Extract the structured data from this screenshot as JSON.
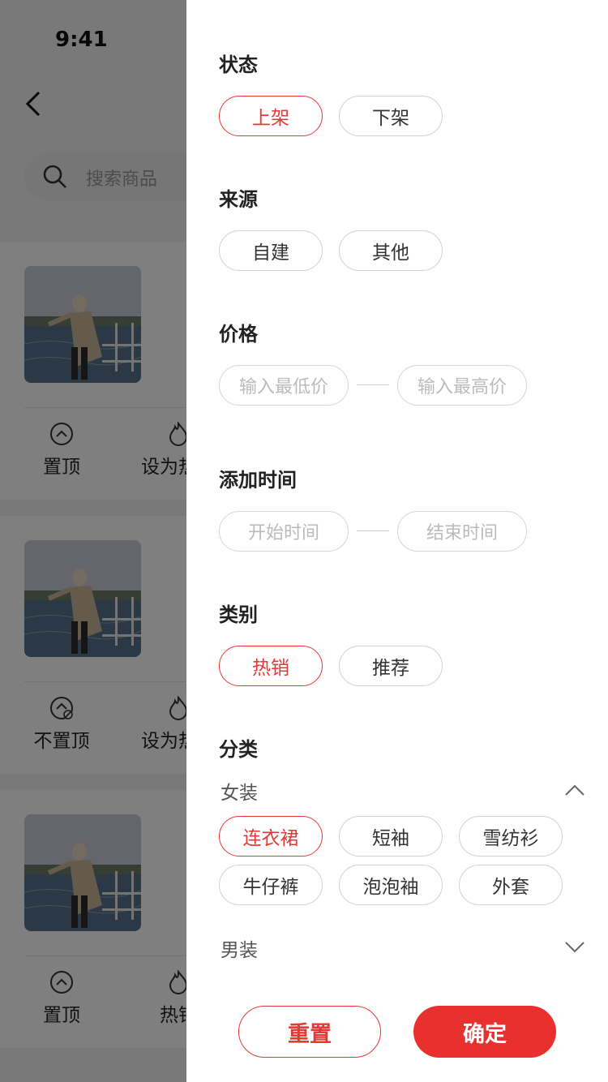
{
  "status_bar": {
    "time": "9:41"
  },
  "search": {
    "placeholder": "搜索商品"
  },
  "products": [
    {
      "actions": [
        "置顶",
        "设为热销"
      ]
    },
    {
      "actions": [
        "不置顶",
        "设为热销"
      ]
    },
    {
      "actions": [
        "置顶",
        "热销"
      ]
    }
  ],
  "filter": {
    "status": {
      "title": "状态",
      "options": [
        "上架",
        "下架"
      ],
      "selected": "上架"
    },
    "source": {
      "title": "来源",
      "options": [
        "自建",
        "其他"
      ]
    },
    "price": {
      "title": "价格",
      "min_placeholder": "输入最低价",
      "max_placeholder": "输入最高价"
    },
    "added_time": {
      "title": "添加时间",
      "start_placeholder": "开始时间",
      "end_placeholder": "结束时间"
    },
    "category_type": {
      "title": "类别",
      "options": [
        "热销",
        "推荐"
      ],
      "selected": "热销"
    },
    "classification": {
      "title": "分类",
      "groups": [
        {
          "name": "女装",
          "expanded": true,
          "options": [
            "连衣裙",
            "短袖",
            "雪纺衫",
            "牛仔裤",
            "泡泡袖",
            "外套"
          ],
          "selected": "连衣裙"
        },
        {
          "name": "男装",
          "expanded": false
        }
      ]
    },
    "reset_label": "重置",
    "confirm_label": "确定"
  },
  "colors": {
    "accent": "#e53935",
    "confirm_bg": "#e8302f"
  }
}
